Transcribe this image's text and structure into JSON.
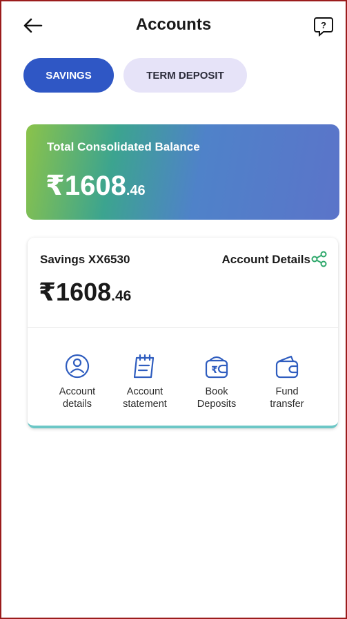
{
  "header": {
    "title": "Accounts",
    "back_icon": "arrow-left-icon",
    "help_icon": "help-chat-icon"
  },
  "tabs": [
    {
      "label": "SAVINGS",
      "selected": true
    },
    {
      "label": "TERM DEPOSIT",
      "selected": false
    }
  ],
  "balance_card": {
    "label": "Total Consolidated Balance",
    "amount_main": "₹1608",
    "amount_decimal": ".46"
  },
  "account_card": {
    "name": "Savings XX6530",
    "details_link": "Account Details",
    "share_icon": "share-icon",
    "amount_main": "₹1608",
    "amount_decimal": ".46",
    "actions": [
      {
        "line1": "Account",
        "line2": "details",
        "icon": "user-circle-icon"
      },
      {
        "line1": "Account",
        "line2": "statement",
        "icon": "statement-icon"
      },
      {
        "line1": "Book",
        "line2": "Deposits",
        "icon": "rupee-wallet-icon"
      },
      {
        "line1": "Fund",
        "line2": "transfer",
        "icon": "wallet-icon"
      }
    ]
  },
  "colors": {
    "primary": "#2f57c5",
    "tab_inactive": "#e6e3f8",
    "accent_green": "#2ea86b",
    "icon_blue": "#2f5dbf"
  }
}
